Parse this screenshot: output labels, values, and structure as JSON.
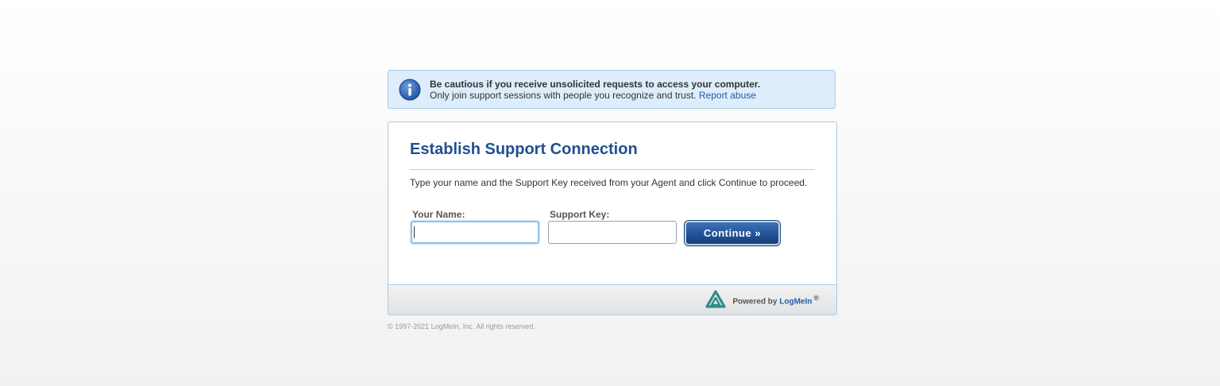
{
  "notice": {
    "icon": "info-icon",
    "title": "Be cautious if you receive unsolicited requests to access your computer.",
    "body": "Only join support sessions with people you recognize and trust.",
    "link_label": "Report abuse"
  },
  "form": {
    "title": "Establish Support Connection",
    "instructions": "Type your name and the Support Key received from your Agent and click Continue to proceed.",
    "name_label": "Your Name:",
    "name_value": "",
    "key_label": "Support Key:",
    "key_value": "",
    "continue_label": "Continue »"
  },
  "footer": {
    "logo_icon": "logmein-logo-icon",
    "powered_by": "Powered by",
    "brand": "LogMeIn",
    "registered": "®"
  },
  "copyright": "© 1997-2021 LogMeIn, Inc. All rights reserved.",
  "colors": {
    "title": "#1f4f8f",
    "link": "#1f5ea8",
    "notice_bg": "#ddedfb",
    "button": "#25569a"
  }
}
